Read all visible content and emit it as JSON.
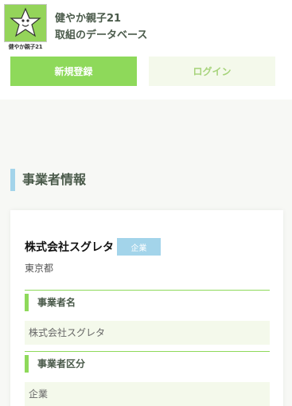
{
  "header": {
    "logo_caption": "健やか親子21",
    "title_line1": "健やか親子21",
    "title_line2": "取組のデータベース",
    "register_label": "新規登録",
    "login_label": "ログイン"
  },
  "section": {
    "heading": "事業者情報"
  },
  "company": {
    "name": "株式会社スグレタ",
    "type_badge": "企業",
    "prefecture": "東京都",
    "fields": [
      {
        "label": "事業者名",
        "value": "株式会社スグレタ"
      },
      {
        "label": "事業者区分",
        "value": "企業"
      }
    ]
  },
  "colors": {
    "accent_green": "#8ed95a",
    "accent_blue": "#a3d4ea",
    "light_green_bg": "#f4f9eb"
  }
}
